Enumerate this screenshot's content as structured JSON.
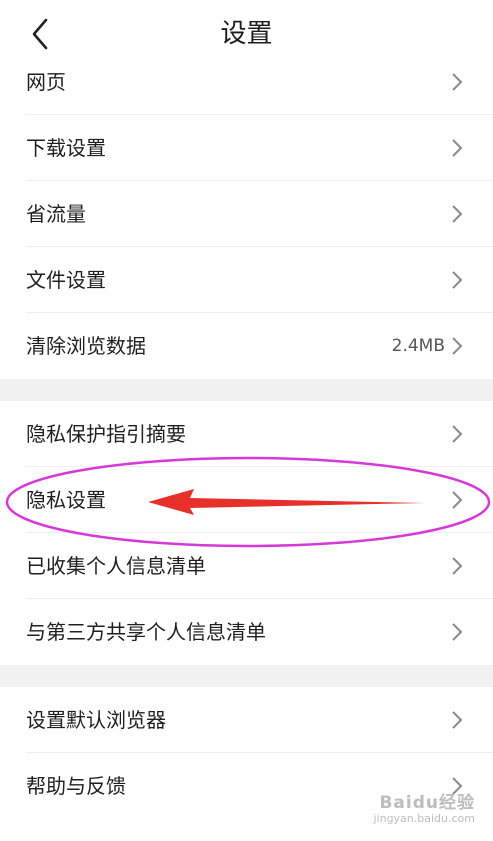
{
  "header": {
    "title": "设置"
  },
  "group1": [
    {
      "label": "网页"
    },
    {
      "label": "下载设置"
    },
    {
      "label": "省流量"
    },
    {
      "label": "文件设置"
    },
    {
      "label": "清除浏览数据",
      "value": "2.4MB"
    }
  ],
  "group2": [
    {
      "label": "隐私保护指引摘要"
    },
    {
      "label": "隐私设置"
    },
    {
      "label": "已收集个人信息清单"
    },
    {
      "label": "与第三方共享个人信息清单"
    }
  ],
  "group3": [
    {
      "label": "设置默认浏览器"
    },
    {
      "label": "帮助与反馈"
    }
  ],
  "watermark": {
    "logo": "Baidu经验",
    "url": "jingyan.baidu.com"
  },
  "colors": {
    "annotation_ellipse": "#d63ad6",
    "annotation_arrow": "#e8302a"
  }
}
